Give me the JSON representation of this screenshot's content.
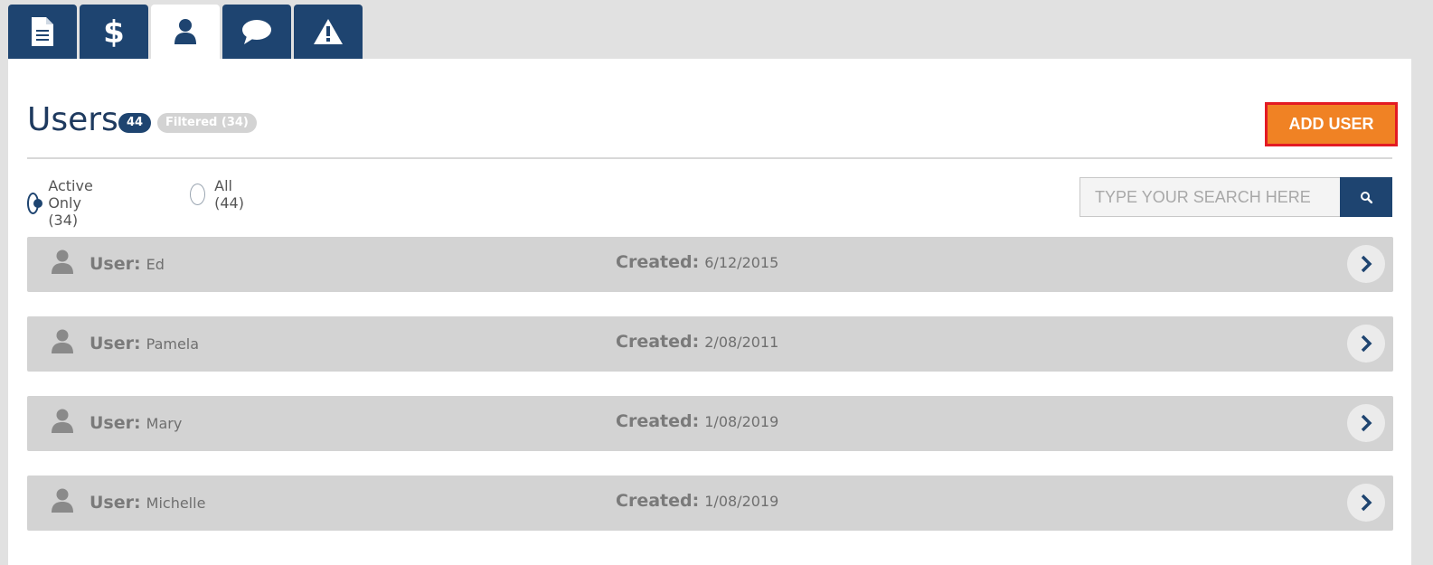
{
  "tabs": [
    {
      "icon": "document-icon",
      "active": false
    },
    {
      "icon": "dollar-icon",
      "active": false
    },
    {
      "icon": "user-icon",
      "active": true
    },
    {
      "icon": "chat-bubble-icon",
      "active": false
    },
    {
      "icon": "warning-icon",
      "active": false
    }
  ],
  "header": {
    "title": "Users",
    "count": "44",
    "filtered": "Filtered (34)",
    "add_user_label": "ADD USER"
  },
  "filters": {
    "active_only_label": "Active Only (34)",
    "all_label": "All (44)",
    "selected": "active_only"
  },
  "search": {
    "placeholder": "TYPE YOUR SEARCH HERE",
    "value": ""
  },
  "users": [
    {
      "user_label": "User:",
      "name": "Ed",
      "created_label": "Created:",
      "created": "6/12/2015"
    },
    {
      "user_label": "User:",
      "name": "Pamela",
      "created_label": "Created:",
      "created": "2/08/2011"
    },
    {
      "user_label": "User:",
      "name": "Mary",
      "created_label": "Created:",
      "created": "1/08/2019"
    },
    {
      "user_label": "User:",
      "name": "Michelle",
      "created_label": "Created:",
      "created": "1/08/2019"
    }
  ],
  "colors": {
    "primary": "#1e4470",
    "accent": "#f08224",
    "highlight_border": "#e31b23",
    "row_bg": "#d3d3d3"
  }
}
